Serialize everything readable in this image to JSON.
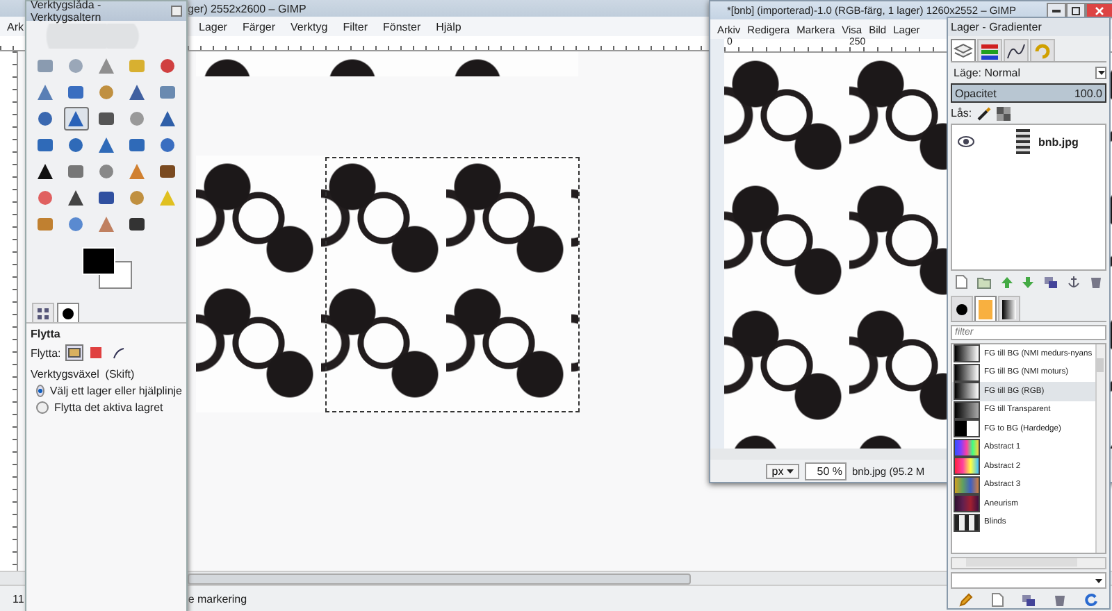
{
  "main_window": {
    "title": "ger) 2552x2600 – GIMP",
    "menu_left": [
      "Ark"
    ],
    "menu": [
      "Lager",
      "Färger",
      "Verktyg",
      "Filter",
      "Fönster",
      "Hjälp"
    ],
    "status_bar": {
      "unit": "11",
      "message": "e markering"
    }
  },
  "toolbox": {
    "title": "Verktygslåda - Verktygsaltern",
    "tools": [
      {
        "selected": false
      },
      {
        "selected": false
      },
      {
        "selected": false
      },
      {
        "selected": false
      },
      {
        "selected": false
      },
      {
        "selected": false
      },
      {
        "selected": false
      },
      {
        "selected": false
      },
      {
        "selected": false
      },
      {
        "selected": false
      },
      {
        "selected": false
      },
      {
        "selected": true
      },
      {
        "selected": false
      },
      {
        "selected": false
      },
      {
        "selected": false
      },
      {
        "selected": false
      },
      {
        "selected": false
      },
      {
        "selected": false
      },
      {
        "selected": false
      },
      {
        "selected": false
      },
      {
        "selected": false
      },
      {
        "selected": false
      },
      {
        "selected": false
      },
      {
        "selected": false
      },
      {
        "selected": false
      },
      {
        "selected": false
      },
      {
        "selected": false
      },
      {
        "selected": false
      },
      {
        "selected": false
      },
      {
        "selected": false
      },
      {
        "selected": false
      },
      {
        "selected": false
      },
      {
        "selected": false
      },
      {
        "selected": false
      }
    ],
    "option_tabs": [
      {
        "selected": false
      },
      {
        "selected": true
      }
    ],
    "tool_name": "Flytta",
    "move_label": "Flytta:",
    "move_modes": [
      {
        "selected": true
      },
      {
        "selected": false
      },
      {
        "selected": false
      }
    ],
    "switch_label": "Verktygsväxel  (Skift)",
    "options": [
      {
        "label": "Välj ett lager eller hjälplinje",
        "selected": true
      },
      {
        "label": "Flytta det aktiva lagret",
        "selected": false
      }
    ]
  },
  "image_window": {
    "title": "*[bnb] (importerad)-1.0 (RGB-färg, 1 lager) 1260x2552 – GIMP",
    "menu": [
      "Arkiv",
      "Redigera",
      "Markera",
      "Visa",
      "Bild",
      "Lager"
    ],
    "ruler_labels": [
      "0",
      "250"
    ],
    "unit": "px",
    "zoom": "50 %",
    "status": "bnb.jpg (95.2 M"
  },
  "dock": {
    "title": "Lager - Gradienter",
    "tabs": [
      {
        "selected": true
      },
      {
        "selected": false
      },
      {
        "selected": false
      },
      {
        "selected": false
      }
    ],
    "mode_label": "Läge: Normal",
    "opacity": {
      "label": "Opacitet",
      "value": "100.0",
      "level": 1
    },
    "lock_label": "Lås:",
    "layers": [
      {
        "name": "bnb.jpg",
        "visible": true
      }
    ],
    "tabs2": [
      {
        "selected": false
      },
      {
        "selected": true
      },
      {
        "selected": false
      }
    ],
    "filter_placeholder": "filter",
    "gradients": [
      {
        "name": "FG till BG (NMI medurs-nyans",
        "selected": false
      },
      {
        "name": "FG till BG (NMI moturs)",
        "selected": false
      },
      {
        "name": "FG till BG (RGB)",
        "selected": true
      },
      {
        "name": "FG till Transparent",
        "selected": false
      },
      {
        "name": "FG to BG (Hardedge)",
        "selected": false
      },
      {
        "name": "Abstract 1",
        "selected": false
      },
      {
        "name": "Abstract 2",
        "selected": false
      },
      {
        "name": "Abstract 3",
        "selected": false
      },
      {
        "name": "Aneurism",
        "selected": false
      },
      {
        "name": "Blinds",
        "selected": false
      }
    ]
  }
}
